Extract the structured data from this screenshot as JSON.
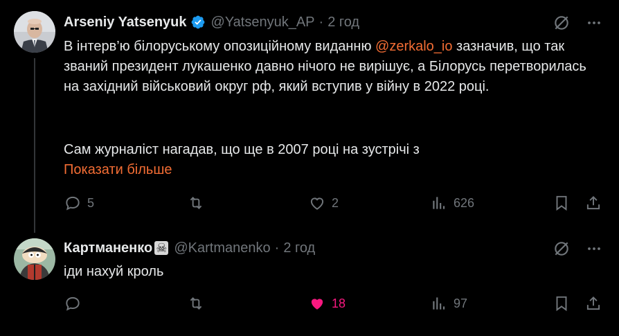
{
  "tweet1": {
    "name": "Arseniy Yatsenyuk",
    "handle": "@Yatsenyuk_AP",
    "dot": "·",
    "time": "2 год",
    "text_before_link": "В інтерв’ю білоруському опозиційному виданню ",
    "link": "@zerkalo_io",
    "text_after_link": " зазначив, що так званий президент лукашенко давно нічого не вирішує, а Білорусь перетворилась на західний  військовий округ рф, який вступив у війну в 2022 році.",
    "text_para2": "Сам журналіст нагадав, що ще в 2007 році на зустрічі з",
    "show_more": "Показати більше",
    "replies": "5",
    "likes": "2",
    "views": "626"
  },
  "tweet2": {
    "name": "Картманенко",
    "name_emoji": "☠",
    "handle": "@Kartmanenko",
    "dot": "·",
    "time": "2 год",
    "text": "іди нахуй кроль",
    "likes": "18",
    "views": "97"
  },
  "colors": {
    "accent_link": "#f36d34",
    "muted": "#71767b",
    "like_pink": "#f91880",
    "verified_blue": "#1d9bf0"
  },
  "icons": [
    "grok-icon",
    "more-icon",
    "reply-icon",
    "retweet-icon",
    "like-icon",
    "views-icon",
    "bookmark-icon",
    "share-icon"
  ]
}
